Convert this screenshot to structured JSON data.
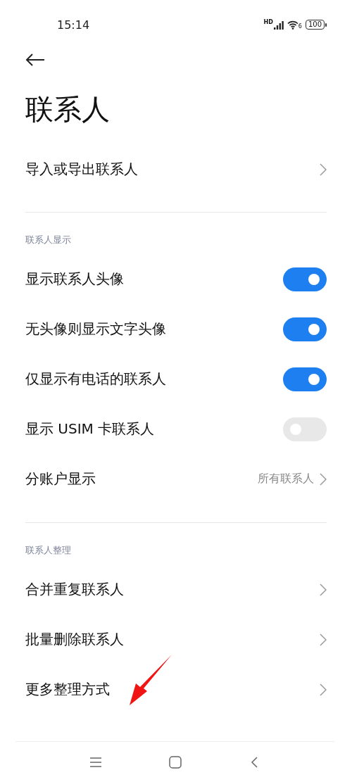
{
  "status_bar": {
    "time": "15:14",
    "signal_label": "HD",
    "wifi_label": "6",
    "battery": "100"
  },
  "title": "联系人",
  "sections": [
    {
      "items": [
        {
          "kind": "link",
          "label": "导入或导出联系人"
        }
      ]
    },
    {
      "header": "联系人显示",
      "items": [
        {
          "kind": "toggle",
          "label": "显示联系人头像",
          "on": true
        },
        {
          "kind": "toggle",
          "label": "无头像则显示文字头像",
          "on": true
        },
        {
          "kind": "toggle",
          "label": "仅显示有电话的联系人",
          "on": true
        },
        {
          "kind": "toggle",
          "label": "显示 USIM 卡联系人",
          "on": false
        },
        {
          "kind": "value",
          "label": "分账户显示",
          "value": "所有联系人"
        }
      ]
    },
    {
      "header": "联系人整理",
      "items": [
        {
          "kind": "link",
          "label": "合并重复联系人"
        },
        {
          "kind": "link",
          "label": "批量删除联系人"
        },
        {
          "kind": "link",
          "label": "更多整理方式"
        }
      ]
    }
  ]
}
